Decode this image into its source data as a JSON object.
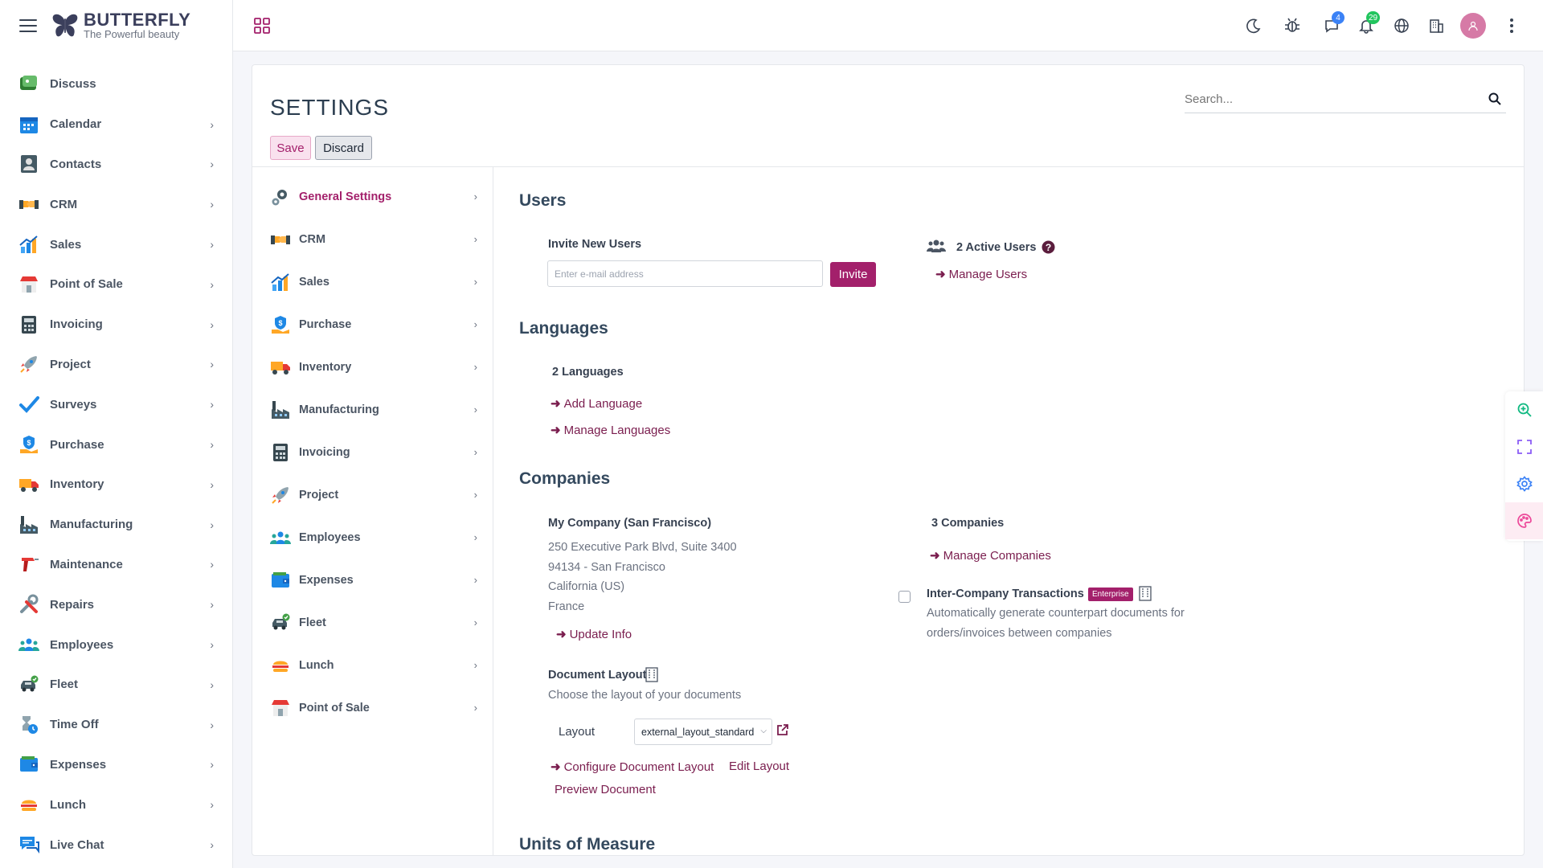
{
  "brand": {
    "name": "BUTTERFLY",
    "tagline": "The Powerful beauty"
  },
  "sidebar": {
    "items": [
      {
        "label": "Discuss",
        "icon": "discuss-icon"
      },
      {
        "label": "Calendar",
        "icon": "calendar-icon"
      },
      {
        "label": "Contacts",
        "icon": "contacts-icon"
      },
      {
        "label": "CRM",
        "icon": "crm-handshake-icon"
      },
      {
        "label": "Sales",
        "icon": "sales-chart-icon"
      },
      {
        "label": "Point of Sale",
        "icon": "shop-icon"
      },
      {
        "label": "Invoicing",
        "icon": "calculator-icon"
      },
      {
        "label": "Project",
        "icon": "rocket-icon"
      },
      {
        "label": "Surveys",
        "icon": "checkmark-icon"
      },
      {
        "label": "Purchase",
        "icon": "purchase-hand-icon"
      },
      {
        "label": "Inventory",
        "icon": "truck-icon"
      },
      {
        "label": "Manufacturing",
        "icon": "factory-icon"
      },
      {
        "label": "Maintenance",
        "icon": "drill-icon"
      },
      {
        "label": "Repairs",
        "icon": "tools-icon"
      },
      {
        "label": "Employees",
        "icon": "employees-icon"
      },
      {
        "label": "Fleet",
        "icon": "car-icon"
      },
      {
        "label": "Time Off",
        "icon": "hourglass-icon"
      },
      {
        "label": "Expenses",
        "icon": "wallet-icon"
      },
      {
        "label": "Lunch",
        "icon": "burger-icon"
      },
      {
        "label": "Live Chat",
        "icon": "chat-icon"
      }
    ]
  },
  "topbar": {
    "messages_badge": "4",
    "notifications_badge": "29"
  },
  "settings": {
    "title": "SETTINGS",
    "save_label": "Save",
    "discard_label": "Discard",
    "search_placeholder": "Search...",
    "nav": [
      {
        "label": "General Settings",
        "icon": "gears-icon"
      },
      {
        "label": "CRM",
        "icon": "crm-handshake-icon"
      },
      {
        "label": "Sales",
        "icon": "sales-chart-icon"
      },
      {
        "label": "Purchase",
        "icon": "purchase-hand-icon"
      },
      {
        "label": "Inventory",
        "icon": "truck-icon"
      },
      {
        "label": "Manufacturing",
        "icon": "factory-icon"
      },
      {
        "label": "Invoicing",
        "icon": "calculator-icon"
      },
      {
        "label": "Project",
        "icon": "rocket-icon"
      },
      {
        "label": "Employees",
        "icon": "employees-icon"
      },
      {
        "label": "Expenses",
        "icon": "wallet-icon"
      },
      {
        "label": "Fleet",
        "icon": "car-icon"
      },
      {
        "label": "Lunch",
        "icon": "burger-icon"
      },
      {
        "label": "Point of Sale",
        "icon": "shop-icon"
      }
    ]
  },
  "users": {
    "heading": "Users",
    "invite_label": "Invite New Users",
    "email_placeholder": "Enter e-mail address",
    "invite_button": "Invite",
    "active_users": "2 Active Users",
    "manage_users": "Manage Users"
  },
  "languages": {
    "heading": "Languages",
    "count": "2 Languages",
    "add_language": "Add Language",
    "manage_languages": "Manage Languages"
  },
  "companies": {
    "heading": "Companies",
    "company_name": "My Company (San Francisco)",
    "address_line1": "250 Executive Park Blvd, Suite 3400",
    "address_line2": "94134 - San Francisco",
    "address_line3": "California (US)",
    "address_line4": "France",
    "update_info": "Update Info",
    "count": "3 Companies",
    "manage_companies": "Manage Companies",
    "inter_company_label": "Inter-Company Transactions",
    "enterprise_badge": "Enterprise",
    "inter_company_desc1": "Automatically generate counterpart documents for",
    "inter_company_desc2": "orders/invoices between companies",
    "doc_layout_label": "Document Layout",
    "doc_layout_desc": "Choose the layout of your documents",
    "layout_field_label": "Layout",
    "layout_value": "external_layout_standard",
    "configure_layout": "Configure Document Layout",
    "edit_layout": "Edit Layout",
    "preview_document": "Preview Document"
  },
  "uom": {
    "heading": "Units of Measure"
  }
}
